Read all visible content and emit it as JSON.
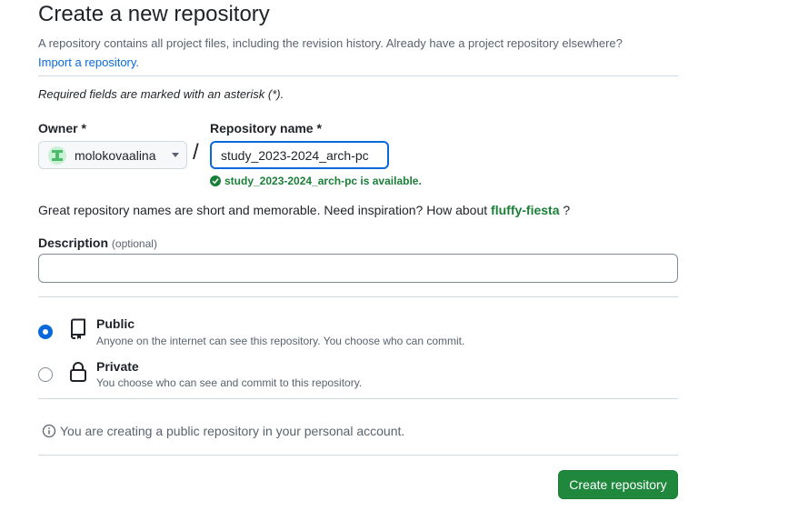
{
  "header": {
    "title": "Create a new repository",
    "subtitle": "A repository contains all project files, including the revision history. Already have a project repository elsewhere?",
    "import_link": "Import a repository."
  },
  "form": {
    "required_note": "Required fields are marked with an asterisk (*).",
    "owner_label": "Owner *",
    "owner_value": "molokovaalina",
    "separator": "/",
    "repo_label": "Repository name *",
    "repo_value": "study_2023-2024_arch-pc",
    "availability": "study_2023-2024_arch-pc is available.",
    "inspiration_text": "Great repository names are short and memorable. Need inspiration? How about",
    "inspiration_name": "fluffy-fiesta",
    "inspiration_end": "?",
    "description_label": "Description",
    "description_optional": "(optional)",
    "description_value": ""
  },
  "visibility": {
    "selected": "public",
    "options": [
      {
        "title": "Public",
        "desc": "Anyone on the internet can see this repository. You choose who can commit.",
        "icon": "repo-icon"
      },
      {
        "title": "Private",
        "desc": "You choose who can see and commit to this repository.",
        "icon": "lock-icon"
      }
    ]
  },
  "info_note": "You are creating a public repository in your personal account.",
  "actions": {
    "create_label": "Create repository"
  },
  "colors": {
    "accent": "#0969da",
    "success": "#1a7f37",
    "primary_button": "#1f883d"
  }
}
